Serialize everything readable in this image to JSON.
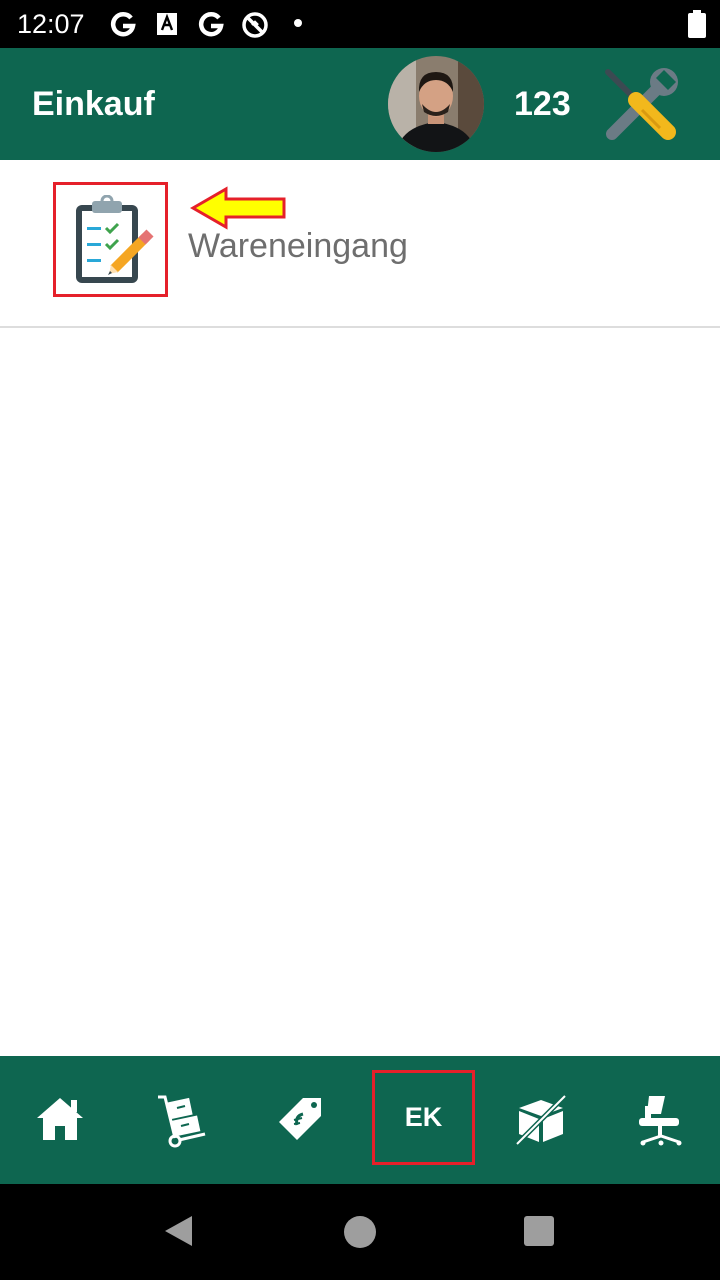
{
  "status_bar": {
    "time": "12:07",
    "icons": [
      "google-g-icon",
      "text-a-icon",
      "google-g-icon",
      "blocked-notification-icon",
      "dot-icon"
    ],
    "battery": "battery-full-icon"
  },
  "app_bar": {
    "title": "Einkauf",
    "user_number": "123",
    "avatar_icon": "user-avatar",
    "tools_icon": "wrench-screwdriver-icon",
    "background": "#0e6650"
  },
  "list": {
    "items": [
      {
        "label": "Wareneingang",
        "icon": "clipboard-checklist-icon"
      }
    ]
  },
  "annotations": {
    "highlight_color": "#e5202a",
    "arrow_color": "#ffff00"
  },
  "bottom_nav": {
    "items": [
      {
        "icon": "home-icon"
      },
      {
        "icon": "hand-truck-icon"
      },
      {
        "icon": "price-tag-icon"
      },
      {
        "label": "EK"
      },
      {
        "icon": "box-crossed-icon"
      },
      {
        "icon": "office-chair-icon"
      }
    ]
  },
  "system_nav": {
    "back": "back-icon",
    "home": "home-circle-icon",
    "recents": "recents-icon"
  }
}
